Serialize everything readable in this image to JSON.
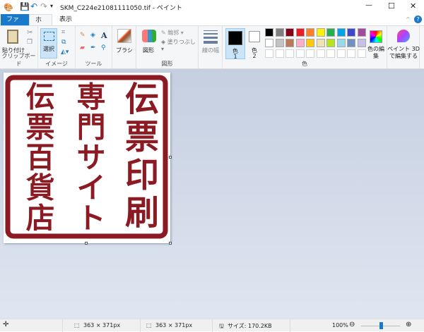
{
  "title": "SKM_C224e21081111050.tif - ペイント",
  "window": {
    "minimize": "—",
    "maximize": "☐",
    "close": "✕"
  },
  "tabs": [
    {
      "label": "ファイル"
    },
    {
      "label": "ホーム"
    },
    {
      "label": "表示"
    }
  ],
  "ribbon": {
    "clipboard": {
      "paste": "貼り付け",
      "group": "クリップボード"
    },
    "image": {
      "select": "選択",
      "group": "イメージ"
    },
    "tools": {
      "group": "ツール"
    },
    "brush": {
      "label": "ブラシ"
    },
    "shapes": {
      "label": "図形",
      "outline": "輪郭 ▾",
      "fill": "塗りつぶし ▾",
      "group": "図形"
    },
    "size": {
      "label": "線の幅"
    },
    "colors": {
      "color1": "色",
      "color1_num": "1",
      "color2": "色",
      "color2_num": "2",
      "edit": "色の編集",
      "group": "色",
      "palette_row1": [
        "#000000",
        "#7f7f7f",
        "#880015",
        "#ed1c24",
        "#ff7f27",
        "#fff200",
        "#22b14c",
        "#00a2e8",
        "#3f48cc",
        "#a349a4"
      ],
      "palette_row2": [
        "#ffffff",
        "#c3c3c3",
        "#b97a57",
        "#ffaec9",
        "#ffc90e",
        "#efe4b0",
        "#b5e61d",
        "#99d9ea",
        "#7092be",
        "#c8bfe7"
      ],
      "color1_value": "#000000",
      "color2_value": "#ffffff"
    },
    "paint3d": {
      "label": "ペイント 3D で編集する"
    }
  },
  "seal": {
    "columns": [
      "伝票印刷",
      "専門サイト",
      "伝票百貨店"
    ],
    "color": "#8b1a22"
  },
  "status": {
    "selection_size": "363 × 371px",
    "image_size": "363 × 371px",
    "file_size": "サイズ: 170.2KB",
    "zoom": "100%",
    "zoom_level": 100
  }
}
